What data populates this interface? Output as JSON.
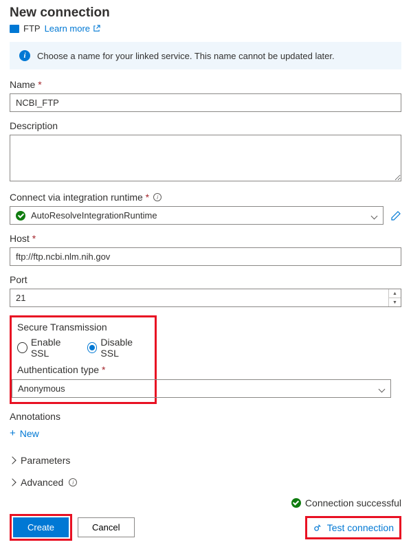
{
  "header": {
    "title": "New connection",
    "connector_type": "FTP",
    "learn_more": "Learn more"
  },
  "info_banner": {
    "text": "Choose a name for your linked service. This name cannot be updated later."
  },
  "fields": {
    "name_label": "Name",
    "name_value": "NCBI_FTP",
    "description_label": "Description",
    "description_value": "",
    "ir_label": "Connect via integration runtime",
    "ir_value": "AutoResolveIntegrationRuntime",
    "host_label": "Host",
    "host_value": "ftp://ftp.ncbi.nlm.nih.gov",
    "port_label": "Port",
    "port_value": "21"
  },
  "secure": {
    "title": "Secure Transmission",
    "enable_label": "Enable SSL",
    "disable_label": "Disable SSL",
    "selected": "disable"
  },
  "auth": {
    "label": "Authentication type",
    "value": "Anonymous"
  },
  "annotations": {
    "label": "Annotations",
    "new_label": "New"
  },
  "expandables": {
    "parameters": "Parameters",
    "advanced": "Advanced"
  },
  "status": {
    "text": "Connection successful"
  },
  "footer": {
    "create": "Create",
    "cancel": "Cancel",
    "test_connection": "Test connection"
  }
}
